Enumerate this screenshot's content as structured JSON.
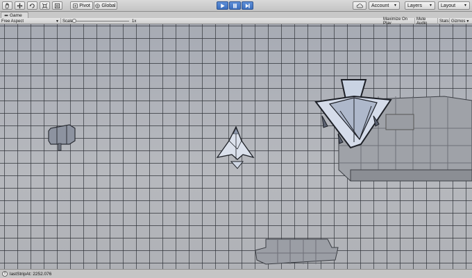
{
  "toolbar": {
    "tools": [
      "hand-icon",
      "move-icon",
      "rotate-icon",
      "scale-icon",
      "rect-icon"
    ],
    "pivot_label": "Pivot",
    "global_label": "Global",
    "account_label": "Account",
    "layers_label": "Layers",
    "layout_label": "Layout"
  },
  "tab": {
    "title": "Game"
  },
  "gamebar": {
    "aspect": "Free Aspect",
    "scale_label": "Scale",
    "scale_value": "1x",
    "maximize": "Maximize On Play",
    "mute": "Mute Audio",
    "stats": "Stats",
    "gizmos": "Gizmos"
  },
  "status": {
    "text": "lastStripAt: 2252.076"
  }
}
